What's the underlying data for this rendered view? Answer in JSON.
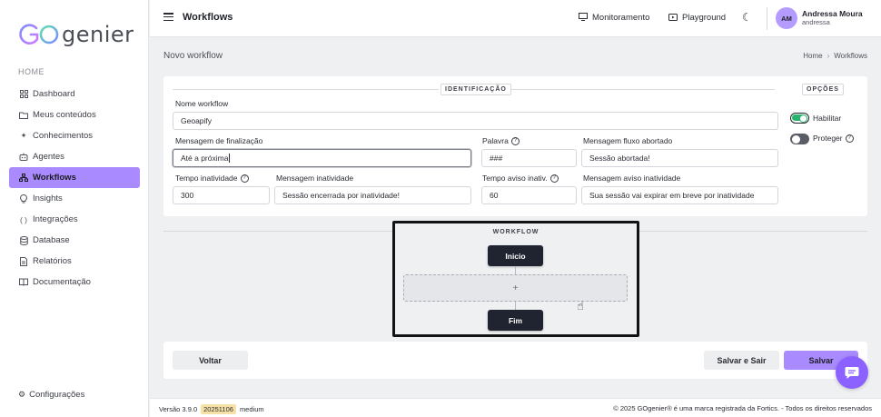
{
  "brand": {
    "logo_text": "genier",
    "logo_go": "GO"
  },
  "sidebar": {
    "section": "HOME",
    "items": [
      {
        "label": "Dashboard",
        "icon": "grid-icon",
        "active": false
      },
      {
        "label": "Meus conteúdos",
        "icon": "folder-icon",
        "active": false
      },
      {
        "label": "Conhecimentos",
        "icon": "sparkle-icon",
        "active": false
      },
      {
        "label": "Agentes",
        "icon": "robot-icon",
        "active": false
      },
      {
        "label": "Workflows",
        "icon": "network-icon",
        "active": true
      },
      {
        "label": "Insights",
        "icon": "lightbulb-icon",
        "active": false
      },
      {
        "label": "Integrações",
        "icon": "braces-icon",
        "active": false
      },
      {
        "label": "Database",
        "icon": "database-icon",
        "active": false
      },
      {
        "label": "Relatórios",
        "icon": "report-icon",
        "active": false
      },
      {
        "label": "Documentação",
        "icon": "book-icon",
        "active": false
      }
    ],
    "settings_label": "Configurações"
  },
  "topbar": {
    "title": "Workflows",
    "monitor_label": "Monitoramento",
    "playground_label": "Playground",
    "user": {
      "initials": "AM",
      "name": "Andressa Moura",
      "login": "andressa"
    }
  },
  "page": {
    "title": "Novo workflow",
    "breadcrumb": [
      "Home",
      "Workflows"
    ]
  },
  "form": {
    "section_label": "IDENTIFICAÇÃO",
    "options_label": "OPÇÕES",
    "nome_label": "Nome workflow",
    "nome_value": "Geoapify",
    "finalizacao_label": "Mensagem de finalização",
    "finalizacao_value": "Até a próxima",
    "palavra_label": "Palavra",
    "palavra_value": "###",
    "abortado_label": "Mensagem fluxo abortado",
    "abortado_value": "Sessão abortada!",
    "tempo_inatividade_label": "Tempo inatividade",
    "tempo_inatividade_value": "300",
    "msg_inatividade_label": "Mensagem inatividade",
    "msg_inatividade_value": "Sessão encerrada por inatividade!",
    "tempo_aviso_label": "Tempo aviso inativ.",
    "tempo_aviso_value": "60",
    "msg_aviso_label": "Mensagem aviso inatividade",
    "msg_aviso_value": "Sua sessão vai expirar em breve por inatividade",
    "habilitar_label": "Habilitar",
    "habilitar_on": true,
    "proteger_label": "Proteger",
    "proteger_on": false
  },
  "workflow": {
    "title": "WORKFLOW",
    "start_label": "Inicio",
    "add_label": "+",
    "end_label": "Fim"
  },
  "actions": {
    "back_label": "Voltar",
    "save_exit_label": "Salvar e Sair",
    "save_label": "Salvar"
  },
  "status": {
    "version": "Versão 3.9.0",
    "build": "20251106",
    "level": "medium",
    "copyright": "© 2025 GOgenier® é uma marca registrada da Fortics. - Todos os direitos reservados"
  },
  "colors": {
    "accent": "#a98bff",
    "chat": "#8b62ff",
    "node": "#1f2430",
    "toggle_on": "#27b36a"
  }
}
